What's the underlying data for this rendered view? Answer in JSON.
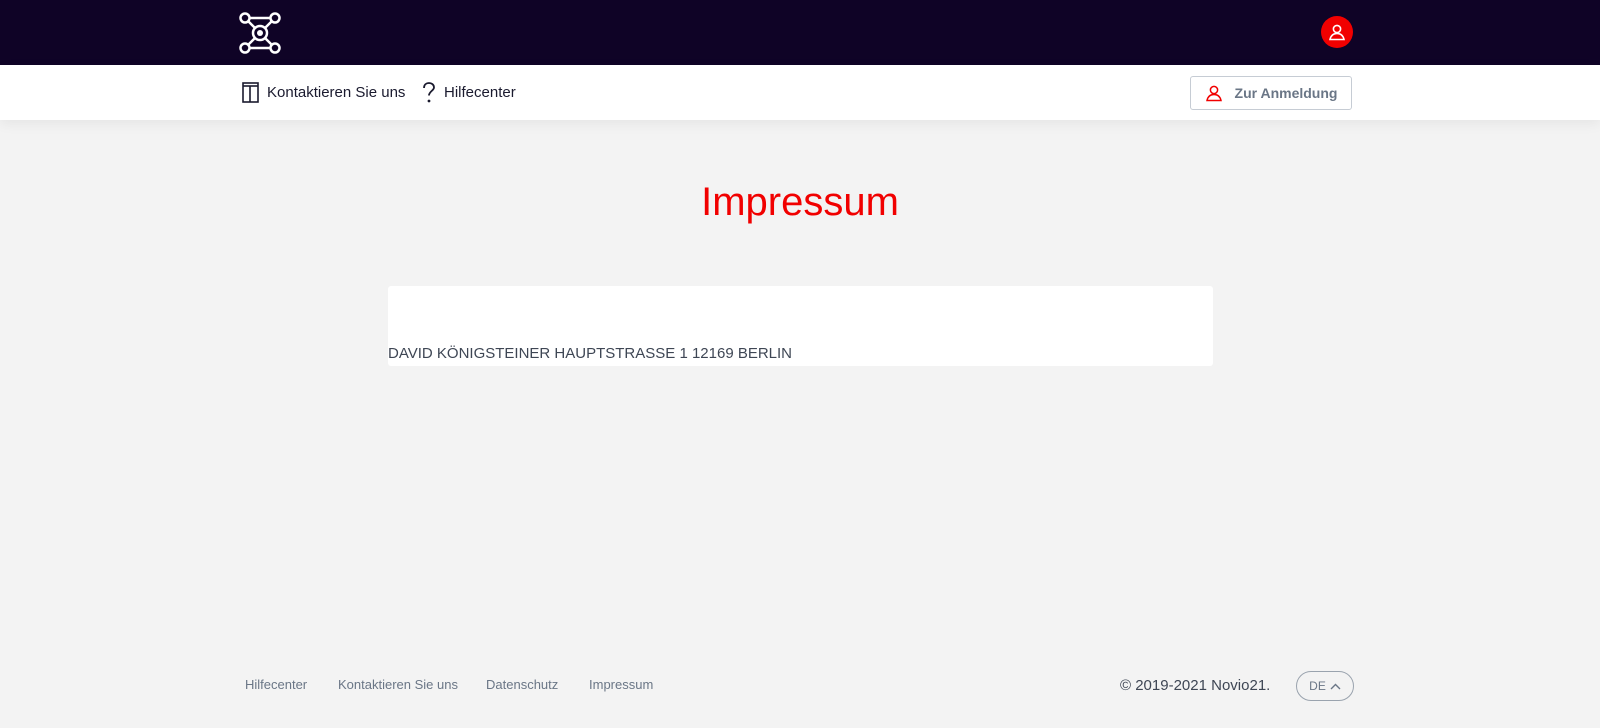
{
  "header": {
    "logo_icon": "network-hub-logo-icon",
    "user_icon": "user-icon",
    "accent_color": "#f10000",
    "background_color": "#0f0326"
  },
  "nav": {
    "contact_label": "Kontaktieren Sie uns",
    "contact_icon": "door-icon",
    "help_label": "Hilfecenter",
    "help_icon": "question-icon",
    "login_label": "Zur Anmeldung",
    "login_icon": "user-icon"
  },
  "main": {
    "title": "Impressum",
    "address": "DAVID KÖNIGSTEINER HAUPTSTRASSE 1 12169 BERLIN"
  },
  "footer": {
    "links": [
      "Hilfecenter",
      "Kontaktieren Sie uns",
      "Datenschutz",
      "Impressum"
    ],
    "copyright": "© 2019-2021 Novio21.",
    "language": "DE",
    "language_icon": "chevron-up-icon"
  }
}
